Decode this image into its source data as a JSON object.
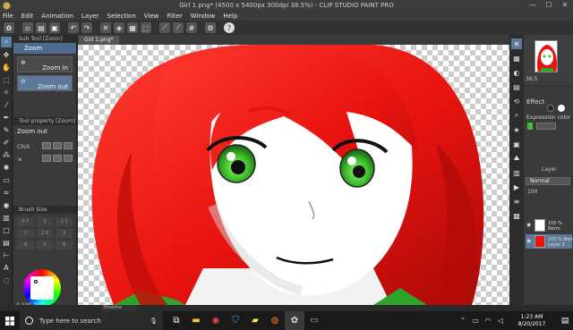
{
  "window": {
    "title": "Girl 1.png* (4500 x 5400px 300dpi 38.5%) - CLIP STUDIO PAINT PRO",
    "minimize": "—",
    "maximize": "☐",
    "close": "✕"
  },
  "menu": [
    "File",
    "Edit",
    "Animation",
    "Layer",
    "Selection",
    "View",
    "Filter",
    "Window",
    "Help"
  ],
  "subtool": {
    "panel_title": "Sub Tool [Zoom]",
    "tab": "Zoom",
    "items": [
      "Zoom in",
      "Zoom out"
    ]
  },
  "tool_property": {
    "panel_title": "Tool property [Zoom]",
    "current": "Zoom out",
    "click_label": "Click",
    "brush_size_title": "Brush Size",
    "brush_sizes": [
      "0.7",
      "1",
      "1.5",
      "2",
      "2.5",
      "3",
      "4",
      "5",
      "6"
    ]
  },
  "color": {
    "values": "0   100  100"
  },
  "document": {
    "tab_label": "Girl 1.png*"
  },
  "right_panel": {
    "nav_zoom": "38.5",
    "effect_title": "Effect",
    "expression_color_label": "Expression color",
    "layer_title": "Layer",
    "blend_mode": "Normal",
    "opacity": "100",
    "layers": [
      {
        "name": "100 % Norm"
      },
      {
        "name": "100 % Norm\nLayer 2"
      }
    ]
  },
  "timeline_label": "Timeline",
  "taskbar": {
    "search_placeholder": "Type here to search",
    "time": "1:23 AM",
    "date": "8/20/2017"
  },
  "colors": {
    "hair_red": "#e8130f",
    "eye_green": "#3cbf2a",
    "accent_blue": "#5e7a9a"
  }
}
